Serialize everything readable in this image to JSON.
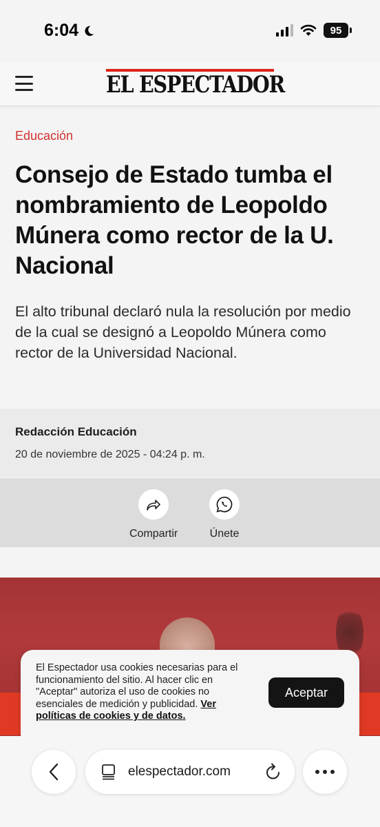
{
  "status_bar": {
    "time": "6:04",
    "battery": "95"
  },
  "header": {
    "logo_text": "EL ESPECTADOR",
    "accent_color": "#e2231a"
  },
  "article": {
    "section": "Educación",
    "headline": "Consejo de Estado tumba el nombramiento de Leopoldo Múnera como rector de la U. Nacional",
    "dek": "El alto tribunal declaró nula la resolución por medio de la cual se designó a Leopoldo Múnera como rector de la Universidad Nacional.",
    "author": "Redacción Educación",
    "date": "20 de noviembre de 2025 - 04:24 p. m."
  },
  "actions": {
    "share_label": "Compartir",
    "join_label": "Únete"
  },
  "cookie_banner": {
    "text": "El Espectador usa cookies necesarias para el funcionamiento del sitio. Al hacer clic en \"Aceptar\" autoriza el uso de cookies no esenciales de medición y publicidad.",
    "link_text": "Ver políticas de cookies y de datos.",
    "accept_label": "Aceptar"
  },
  "browser": {
    "url": "elespectador.com"
  },
  "icons": {
    "menu": "hamburger-icon",
    "share": "share-arrow-icon",
    "whatsapp": "whatsapp-icon",
    "back": "chevron-left-icon",
    "tabs": "page-icon",
    "reload": "reload-icon",
    "more": "more-dots-icon"
  }
}
